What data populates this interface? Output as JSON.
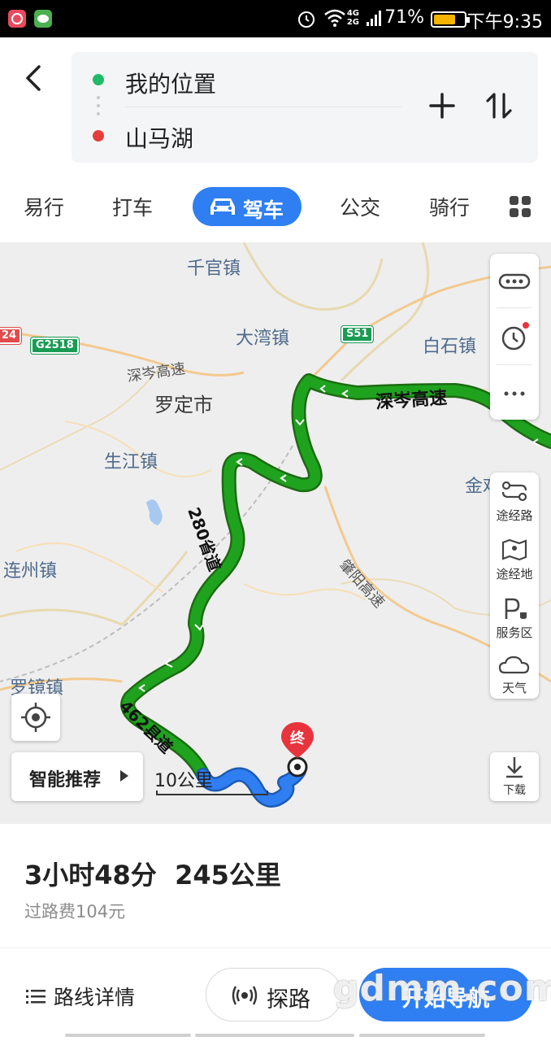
{
  "status_bar": {
    "network": [
      "4G",
      "2G"
    ],
    "battery_text": "71%",
    "battery_level": 0.71,
    "time": "下午9:35"
  },
  "route": {
    "origin": "我的位置",
    "destination": "山马湖",
    "origin_color": "#1fba66",
    "destination_color": "#e63c3c"
  },
  "tabs": [
    {
      "label": "易行"
    },
    {
      "label": "打车"
    },
    {
      "label": "驾车",
      "active": true
    },
    {
      "label": "公交"
    },
    {
      "label": "骑行"
    }
  ],
  "map": {
    "places": [
      "千官镇",
      "大湾镇",
      "白石镇",
      "罗定市",
      "生江镇",
      "连州镇",
      "金鸡",
      "罗镜镇"
    ],
    "road_labels": [
      "深岑高速",
      "肇阳高速"
    ],
    "route_labels": [
      "深岑高速",
      "280省道",
      "462县道"
    ],
    "shields": [
      "G2518",
      "S51",
      "24"
    ],
    "end_marker": "终",
    "side_tools": [
      "途经路",
      "途经地",
      "服务区",
      "天气"
    ],
    "smart_recommend": "智能推荐",
    "scale": "10公里",
    "download": "下载"
  },
  "summary": {
    "duration": "3小时48分",
    "distance": "245公里",
    "toll": "过路费104元"
  },
  "actions": {
    "details": "路线详情",
    "explore": "探路",
    "start": "开始导航"
  },
  "watermark": "gdmm.com",
  "colors": {
    "accent": "#2f7ff2",
    "route_green": "#1fa31f",
    "route_blue": "#2f7ff2"
  }
}
